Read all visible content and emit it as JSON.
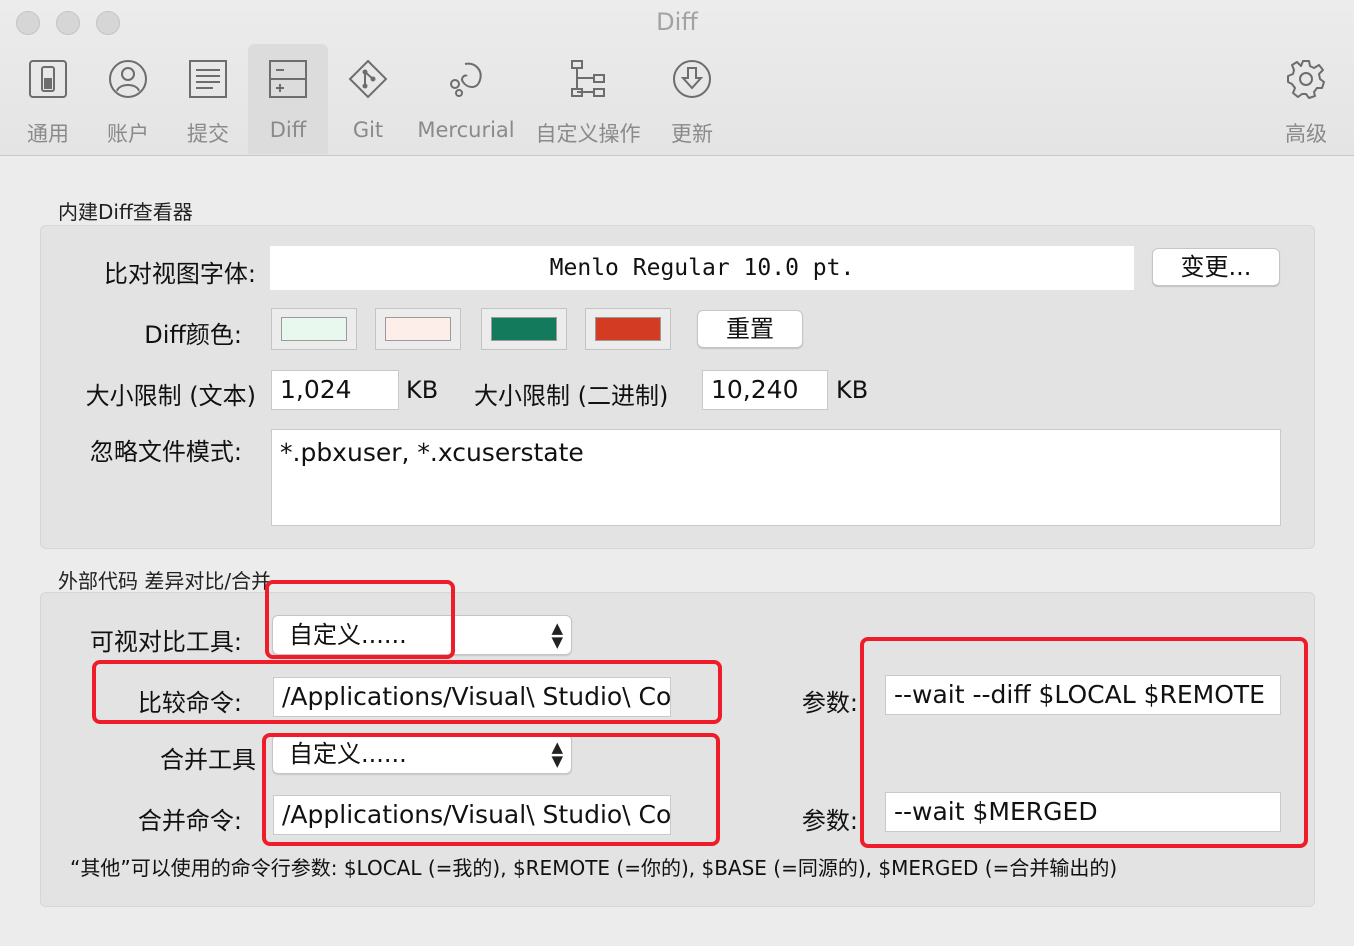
{
  "window": {
    "title": "Diff"
  },
  "toolbar": {
    "items": [
      {
        "label": "通用",
        "icon": "switch-icon"
      },
      {
        "label": "账户",
        "icon": "user-icon"
      },
      {
        "label": "提交",
        "icon": "document-icon"
      },
      {
        "label": "Diff",
        "icon": "diff-icon"
      },
      {
        "label": "Git",
        "icon": "git-icon"
      },
      {
        "label": "Mercurial",
        "icon": "mercurial-icon"
      },
      {
        "label": "自定义操作",
        "icon": "custom-actions-icon"
      },
      {
        "label": "更新",
        "icon": "update-icon"
      },
      {
        "label": "高级",
        "icon": "gear-icon"
      }
    ],
    "active": "Diff"
  },
  "builtin": {
    "title": "内建Diff查看器",
    "font_label": "比对视图字体:",
    "font_value": "Menlo Regular 10.0 pt.",
    "change_button": "变更...",
    "color_label": "Diff颜色:",
    "colors": [
      "#e8f8ee",
      "#fdeeea",
      "#137a5c",
      "#d33c22"
    ],
    "reset_button": "重置",
    "text_limit_label": "大小限制 (文本)",
    "text_limit_value": "1,024",
    "text_limit_unit": "KB",
    "binary_limit_label": "大小限制 (二进制)",
    "binary_limit_value": "10,240",
    "binary_limit_unit": "KB",
    "ignore_label": "忽略文件模式:",
    "ignore_value": "*.pbxuser, *.xcuserstate"
  },
  "external": {
    "title": "外部代码 差异对比/合并",
    "visual_tool_label": "可视对比工具:",
    "visual_tool_value": "自定义......",
    "compare_cmd_label": "比较命令:",
    "compare_cmd_value": "/Applications/Visual\\ Studio\\ Code",
    "compare_args_label": "参数:",
    "compare_args_value": "--wait --diff $LOCAL $REMOTE",
    "merge_tool_label": "合并工具",
    "merge_tool_value": "自定义......",
    "merge_cmd_label": "合并命令:",
    "merge_cmd_value": "/Applications/Visual\\ Studio\\ Code",
    "merge_args_label": "参数:",
    "merge_args_value": "--wait $MERGED",
    "note": "“其他”可以使用的命令行参数: $LOCAL (=我的), $REMOTE (=你的), $BASE (=同源的), $MERGED (=合并输出的)"
  },
  "annotation_color": "#ef1d2a"
}
